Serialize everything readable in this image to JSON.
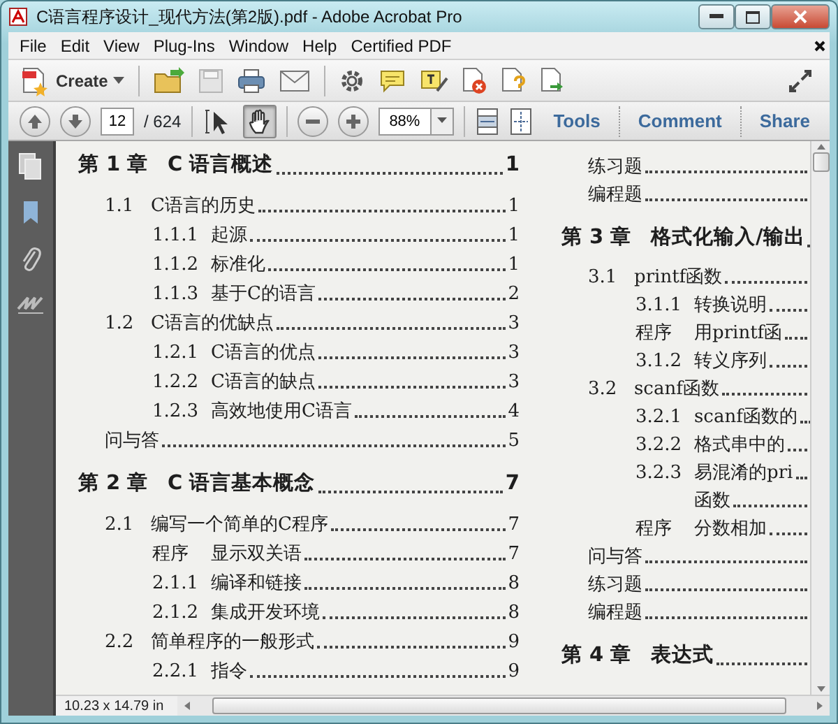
{
  "window": {
    "title": "C语言程序设计_现代方法(第2版).pdf - Adobe Acrobat Pro"
  },
  "menu": [
    "File",
    "Edit",
    "View",
    "Plug-Ins",
    "Window",
    "Help",
    "Certified PDF"
  ],
  "toolbar": {
    "create_label": "Create"
  },
  "navigation": {
    "page_value": "12",
    "page_total": "/ 624",
    "zoom_value": "88%"
  },
  "pointer_tools": [
    {
      "kind": "select",
      "selected": false
    },
    {
      "kind": "hand",
      "selected": true
    }
  ],
  "panes": [
    {
      "label": "Tools",
      "selected": false
    },
    {
      "label": "Comment",
      "selected": false
    },
    {
      "label": "Share",
      "selected": false
    }
  ],
  "document": {
    "columns": [
      {
        "entries": [
          {
            "kind": "chapter",
            "number": "第 1 章",
            "title": "C 语言概述",
            "page": "1"
          },
          {
            "kind": "section",
            "number": "1.1",
            "title": "C语言的历史",
            "page": "1"
          },
          {
            "kind": "subsection",
            "number": "1.1.1",
            "title": "起源",
            "page": "1"
          },
          {
            "kind": "subsection",
            "number": "1.1.2",
            "title": "标准化",
            "page": "1"
          },
          {
            "kind": "subsection",
            "number": "1.1.3",
            "title": "基于C的语言",
            "page": "2"
          },
          {
            "kind": "section",
            "number": "1.2",
            "title": "C语言的优缺点",
            "page": "3"
          },
          {
            "kind": "subsection",
            "number": "1.2.1",
            "title": "C语言的优点",
            "page": "3"
          },
          {
            "kind": "subsection",
            "number": "1.2.2",
            "title": "C语言的缺点",
            "page": "3"
          },
          {
            "kind": "subsection",
            "number": "1.2.3",
            "title": "高效地使用C语言",
            "page": "4"
          },
          {
            "kind": "plain",
            "title": "问与答",
            "page": "5"
          },
          {
            "kind": "chapter",
            "number": "第 2 章",
            "title": "C 语言基本概念",
            "page": "7"
          },
          {
            "kind": "section",
            "number": "2.1",
            "title": "编写一个简单的C程序",
            "page": "7"
          },
          {
            "kind": "subsection",
            "number": "程序",
            "title": "显示双关语",
            "page": "7"
          },
          {
            "kind": "subsection",
            "number": "2.1.1",
            "title": "编译和链接",
            "page": "8"
          },
          {
            "kind": "subsection",
            "number": "2.1.2",
            "title": "集成开发环境",
            "page": "8"
          },
          {
            "kind": "section",
            "number": "2.2",
            "title": "简单程序的一般形式",
            "page": "9"
          },
          {
            "kind": "subsection",
            "number": "2.2.1",
            "title": "指令",
            "page": "9"
          }
        ]
      },
      {
        "entries": [
          {
            "kind": "plain",
            "title": "练习题"
          },
          {
            "kind": "plain",
            "title": "编程题"
          },
          {
            "kind": "chapter",
            "number": "第 3 章",
            "title": "格式化输入/输出"
          },
          {
            "kind": "section",
            "number": "3.1",
            "title": "printf函数"
          },
          {
            "kind": "subsection",
            "number": "3.1.1",
            "title": "转换说明"
          },
          {
            "kind": "subsection",
            "number": "程序",
            "title": "用printf函"
          },
          {
            "kind": "subsection",
            "number": "3.1.2",
            "title": "转义序列"
          },
          {
            "kind": "section",
            "number": "3.2",
            "title": "scanf函数"
          },
          {
            "kind": "subsection",
            "number": "3.2.1",
            "title": "scanf函数的"
          },
          {
            "kind": "subsection",
            "number": "3.2.2",
            "title": "格式串中的"
          },
          {
            "kind": "subsection",
            "number": "3.2.3",
            "title": "易混淆的pri"
          },
          {
            "kind": "continuation",
            "title": "函数"
          },
          {
            "kind": "subsection",
            "number": "程序",
            "title": "分数相加"
          },
          {
            "kind": "plain",
            "title": "问与答"
          },
          {
            "kind": "plain",
            "title": "练习题"
          },
          {
            "kind": "plain",
            "title": "编程题"
          },
          {
            "kind": "chapter",
            "number": "第 4 章",
            "title": "表达式"
          }
        ]
      }
    ]
  },
  "status_bar": {
    "page_size": "10.23 x 14.79 in"
  }
}
